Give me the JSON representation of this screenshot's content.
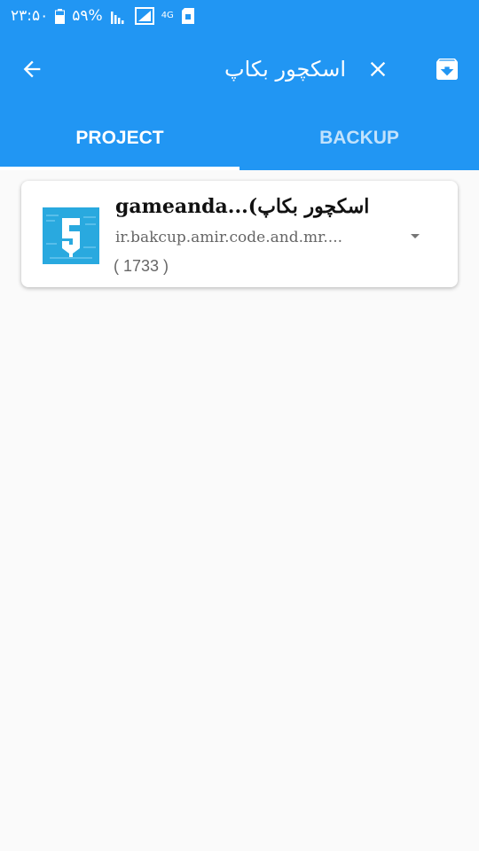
{
  "status_bar": {
    "time": "۲۳:۵۰",
    "battery": "۵۹%",
    "network": "4G"
  },
  "app_bar": {
    "search_text": "اسکچور بکاپ",
    "icons": [
      "arrow-back-icon",
      "close-icon",
      "archive-download-icon"
    ]
  },
  "tabs": [
    {
      "label": "PROJECT",
      "active": true
    },
    {
      "label": "BACKUP",
      "active": false
    }
  ],
  "list": {
    "items": [
      {
        "title": "gameanda...(اسکچور بکاپ",
        "package": "ir.bakcup.amir.code.and.mr....",
        "count": "( 1733 )",
        "icon": "sketchware-app-icon"
      }
    ]
  },
  "colors": {
    "primary": "#2196f3",
    "background": "#fafafa",
    "app_icon_bg": "#29a9df"
  }
}
